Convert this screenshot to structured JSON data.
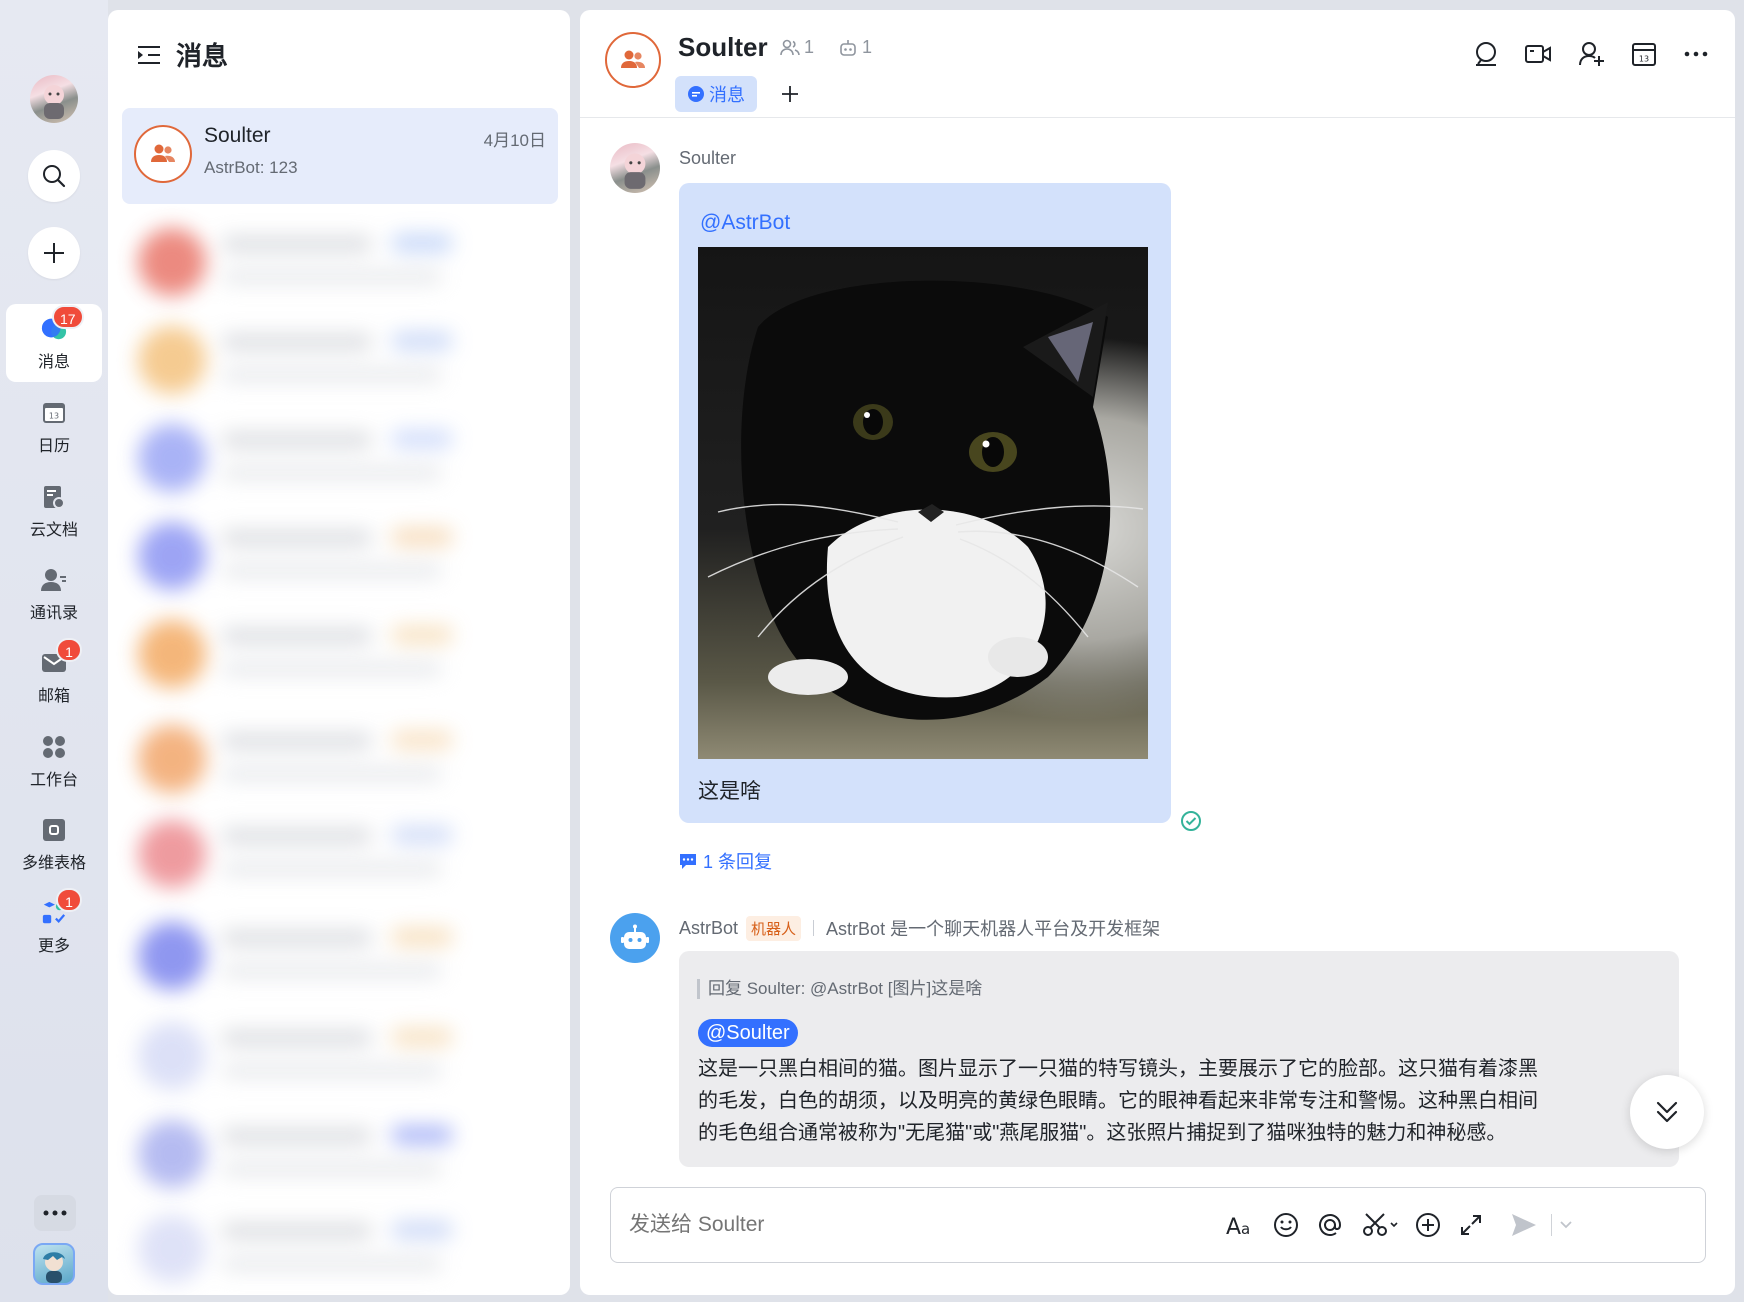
{
  "sidebar": {
    "nav": [
      {
        "label": "消息",
        "badge": "17",
        "icon": "messages-icon"
      },
      {
        "label": "日历",
        "badge": "",
        "icon": "calendar-icon"
      },
      {
        "label": "云文档",
        "badge": "",
        "icon": "cloud-docs-icon"
      },
      {
        "label": "通讯录",
        "badge": "",
        "icon": "contacts-icon"
      },
      {
        "label": "邮箱",
        "badge": "1",
        "icon": "mail-icon"
      },
      {
        "label": "工作台",
        "badge": "",
        "icon": "workplace-icon"
      },
      {
        "label": "多维表格",
        "badge": "",
        "icon": "base-table-icon"
      },
      {
        "label": "更多",
        "badge": "1",
        "icon": "more-apps-icon"
      }
    ],
    "calendar_day": "13"
  },
  "conversations": {
    "title": "消息",
    "items": [
      {
        "name": "Soulter",
        "preview": "AstrBot: 123",
        "time": "4月10日"
      }
    ]
  },
  "chat": {
    "title": "Soulter",
    "member_count": "1",
    "bot_count": "1",
    "tabs": [
      {
        "label": "消息"
      }
    ],
    "messages": [
      {
        "sender": "Soulter",
        "mention": "@AstrBot",
        "text": "这是啥",
        "image": "black-and-white-cat-photo",
        "reply_count": "1 条回复"
      },
      {
        "sender": "AstrBot",
        "tag": "机器人",
        "signature": "AstrBot 是一个聊天机器人平台及开发框架",
        "quote": "回复 Soulter:  @AstrBot [图片]这是啥",
        "mention": "@Soulter",
        "text_lines": [
          "这是一只黑白相间的猫。图片显示了一只猫的特写镜头，主要展示了它的脸部。这只猫有着漆黑",
          "的毛发，白色的胡须，以及明亮的黄绿色眼睛。它的眼神看起来非常专注和警惕。这种黑白相间",
          "的毛色组合通常被称为\"无尾猫\"或\"燕尾服猫\"。这张照片捕捉到了猫咪独特的魅力和神秘感。"
        ]
      }
    ],
    "input_placeholder": "发送给 Soulter"
  },
  "colors": {
    "accent": "#3370ff",
    "bubble": "#d3e1fb",
    "avatar_ring": "#e0683a",
    "badge": "#f04b3a",
    "bot_tag": "#d7601a"
  }
}
